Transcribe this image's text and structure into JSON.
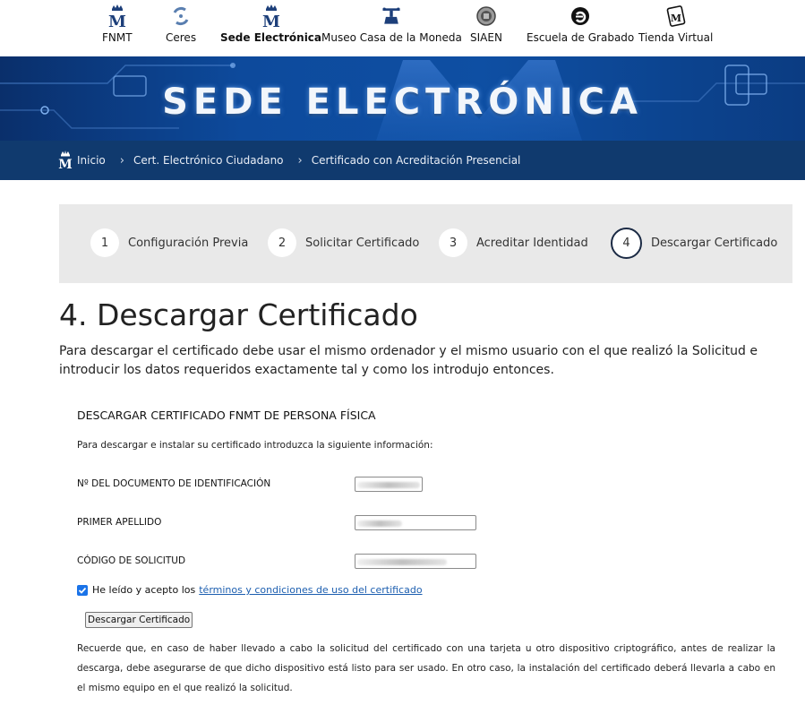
{
  "nav": {
    "items": [
      {
        "label": "FNMT",
        "icon": "crown-m-icon"
      },
      {
        "label": "Ceres",
        "icon": "ceres-logo-icon"
      },
      {
        "label": "Sede Electrónica",
        "icon": "crown-m-icon",
        "active": true
      },
      {
        "label": "Museo Casa de la Moneda",
        "icon": "museum-press-icon"
      },
      {
        "label": "SIAEN",
        "icon": "siaen-seal-icon"
      },
      {
        "label": "Escuela de Grabado",
        "icon": "engraving-school-icon"
      },
      {
        "label": "Tienda Virtual",
        "icon": "virtual-store-icon"
      }
    ]
  },
  "banner": {
    "title": "SEDE ELECTRÓNICA"
  },
  "breadcrumb": {
    "home": "Inicio",
    "items": [
      "Cert. Electrónico Ciudadano",
      "Certificado con Acreditación Presencial"
    ]
  },
  "stepper": {
    "steps": [
      {
        "number": "1",
        "label": "Configuración Previa"
      },
      {
        "number": "2",
        "label": "Solicitar Certificado"
      },
      {
        "number": "3",
        "label": "Acreditar Identidad"
      },
      {
        "number": "4",
        "label": "Descargar Certificado",
        "current": true
      }
    ]
  },
  "page": {
    "title": "4. Descargar Certificado",
    "intro": "Para descargar el certificado debe usar el mismo ordenador y el mismo usuario con el que realizó la Solicitud e introducir los datos requeridos exactamente tal y como los introdujo entonces."
  },
  "form": {
    "section_title": "DESCARGAR CERTIFICADO FNMT DE PERSONA FÍSICA",
    "help": "Para descargar e instalar su certificado introduzca la siguiente información:",
    "fields": [
      {
        "label": "Nº DEL DOCUMENTO DE IDENTIFICACIÓN"
      },
      {
        "label": "PRIMER APELLIDO"
      },
      {
        "label": "CÓDIGO DE SOLICITUD"
      }
    ],
    "accept_text": "He leído y acepto los",
    "terms_link": "términos y condiciones de uso del certificado",
    "accept_checked": true,
    "submit_label": "Descargar Certificado",
    "note": "Recuerde que, en caso de haber llevado a cabo la solicitud del certificado con una tarjeta u otro dispositivo criptográfico, antes de realizar la descarga, debe asegurarse de que dicho dispositivo está listo para ser usado. En otro caso, la instalación del certificado deberá llevarla a cabo en el mismo equipo en el que realizó la solicitud."
  },
  "colors": {
    "banner_blue": "#0d4a9c",
    "breadcrumb_bg": "#103a6e",
    "stepper_bg": "#e9e9e9",
    "link": "#1d5fb0",
    "checkbox": "#1a73e8"
  }
}
